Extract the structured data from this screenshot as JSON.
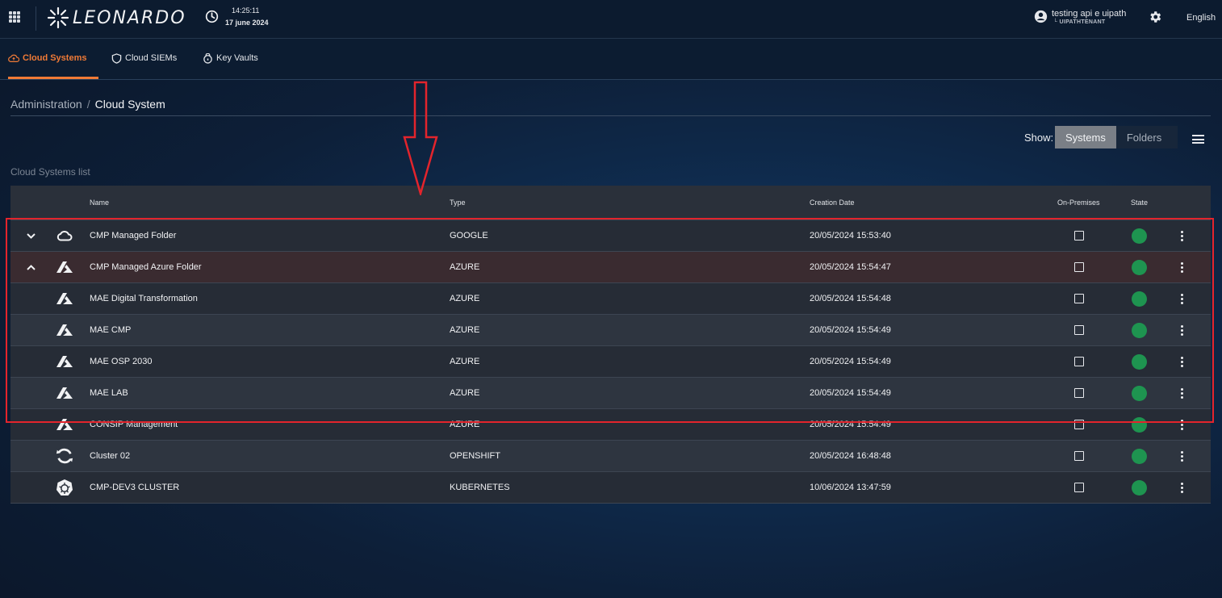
{
  "header": {
    "brand": "LEONARDO",
    "time": "14:25:11",
    "date": "17 june 2024",
    "user_name": "testing api e uipath",
    "user_tenant": "└ UIPATHTENANT",
    "language": "English"
  },
  "tabs": [
    {
      "label": "Cloud Systems",
      "icon": "cloud-upload-icon",
      "active": true
    },
    {
      "label": "Cloud SIEMs",
      "icon": "shield-icon",
      "active": false
    },
    {
      "label": "Key Vaults",
      "icon": "vault-lock-icon",
      "active": false
    }
  ],
  "breadcrumb": {
    "parent": "Administration",
    "separator": "/",
    "current": "Cloud System"
  },
  "view_toggle": {
    "label": "Show:",
    "options": [
      "Systems",
      "Folders"
    ],
    "selected": "Systems"
  },
  "list_title": "Cloud Systems list",
  "table": {
    "headers": {
      "name": "Name",
      "type": "Type",
      "creation_date": "Creation Date",
      "on_premises": "On-Premises",
      "state": "State"
    },
    "rows": [
      {
        "expander": "chevron-down-icon",
        "icon": "google-cloud-icon",
        "name": "CMP Managed Folder",
        "type": "GOOGLE",
        "date": "20/05/2024 15:53:40",
        "on_premises": false,
        "state": "active"
      },
      {
        "expander": "chevron-up-icon",
        "icon": "azure-icon",
        "name": "CMP Managed Azure Folder",
        "type": "AZURE",
        "date": "20/05/2024 15:54:47",
        "on_premises": false,
        "state": "active"
      },
      {
        "expander": "",
        "icon": "azure-icon",
        "name": "MAE Digital Transformation",
        "type": "AZURE",
        "date": "20/05/2024 15:54:48",
        "on_premises": false,
        "state": "active"
      },
      {
        "expander": "",
        "icon": "azure-icon",
        "name": "MAE CMP",
        "type": "AZURE",
        "date": "20/05/2024 15:54:49",
        "on_premises": false,
        "state": "active"
      },
      {
        "expander": "",
        "icon": "azure-icon",
        "name": "MAE OSP 2030",
        "type": "AZURE",
        "date": "20/05/2024 15:54:49",
        "on_premises": false,
        "state": "active"
      },
      {
        "expander": "",
        "icon": "azure-icon",
        "name": "MAE LAB",
        "type": "AZURE",
        "date": "20/05/2024 15:54:49",
        "on_premises": false,
        "state": "active"
      },
      {
        "expander": "",
        "icon": "azure-icon",
        "name": "CONSIP Management",
        "type": "AZURE",
        "date": "20/05/2024 15:54:49",
        "on_premises": false,
        "state": "active"
      },
      {
        "expander": "",
        "icon": "openshift-icon",
        "name": "Cluster 02",
        "type": "OPENSHIFT",
        "date": "20/05/2024 16:48:48",
        "on_premises": false,
        "state": "active"
      },
      {
        "expander": "",
        "icon": "kubernetes-icon",
        "name": "CMP-DEV3 CLUSTER",
        "type": "KUBERNETES",
        "date": "10/06/2024 13:47:59",
        "on_premises": false,
        "state": "active"
      }
    ]
  },
  "colors": {
    "accent": "#f07a36",
    "state_active": "#1e9450",
    "annotation_red": "#e3242c"
  }
}
